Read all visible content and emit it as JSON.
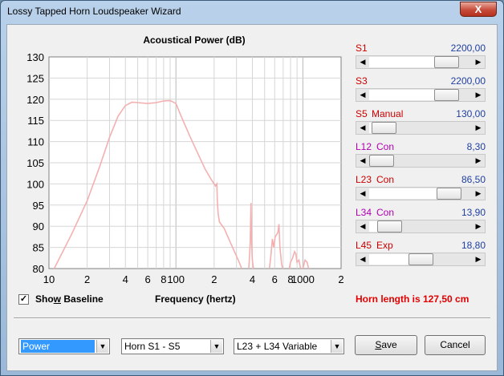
{
  "window": {
    "title": "Lossy Tapped Horn Loudspeaker Wizard",
    "close_label": "X"
  },
  "chart_data": {
    "type": "line",
    "title": "Acoustical Power (dB)",
    "xlabel": "Frequency (hertz)",
    "ylabel": "",
    "xscale": "log",
    "xlim": [
      10,
      2000
    ],
    "ylim": [
      80,
      130
    ],
    "grid": true,
    "y_ticks": [
      "130",
      "125",
      "120",
      "115",
      "110",
      "105",
      "100",
      "95",
      "90",
      "85",
      "80"
    ],
    "x_ticks": [
      "10",
      "2",
      "4",
      "6",
      "8",
      "100",
      "2",
      "4",
      "6",
      "8",
      "1000",
      "2"
    ],
    "line_color": "#f4b0b0",
    "series": [
      {
        "segments": [
          [
            [
              11,
              80
            ],
            [
              15,
              88
            ],
            [
              20,
              96
            ],
            [
              25,
              104
            ],
            [
              30,
              111
            ],
            [
              35,
              116
            ],
            [
              40,
              118.5
            ],
            [
              45,
              119.3
            ],
            [
              50,
              119.2
            ],
            [
              60,
              119
            ],
            [
              70,
              119.2
            ],
            [
              80,
              119.6
            ],
            [
              90,
              119.7
            ],
            [
              100,
              119
            ],
            [
              110,
              116
            ],
            [
              130,
              111
            ],
            [
              150,
              107
            ],
            [
              170,
              103.5
            ],
            [
              190,
              101
            ],
            [
              205,
              99.5
            ],
            [
              210,
              100
            ],
            [
              212,
              96
            ],
            [
              215,
              93
            ],
            [
              220,
              91
            ],
            [
              240,
              89.5
            ],
            [
              270,
              86
            ],
            [
              310,
              82
            ],
            [
              330,
              80
            ]
          ],
          [
            [
              375,
              80
            ],
            [
              385,
              86
            ],
            [
              390,
              95.5
            ],
            [
              395,
              86
            ],
            [
              400,
              82
            ],
            [
              408,
              80
            ]
          ],
          [
            [
              545,
              80
            ],
            [
              560,
              83
            ],
            [
              575,
              87
            ],
            [
              590,
              85
            ],
            [
              605,
              87.5
            ],
            [
              620,
              88
            ],
            [
              635,
              88.5
            ],
            [
              648,
              90.5
            ],
            [
              660,
              85
            ],
            [
              680,
              81
            ],
            [
              695,
              80
            ]
          ],
          [
            [
              780,
              80
            ],
            [
              800,
              81.5
            ],
            [
              830,
              82.5
            ],
            [
              860,
              84
            ],
            [
              880,
              83.5
            ],
            [
              900,
              81.5
            ],
            [
              930,
              82
            ],
            [
              960,
              80
            ]
          ],
          [
            [
              1000,
              80
            ],
            [
              1040,
              82
            ],
            [
              1080,
              81.5
            ],
            [
              1110,
              80
            ]
          ]
        ]
      }
    ]
  },
  "baseline": {
    "label_pre": "Sho",
    "label_u": "w",
    "label_post": " Baseline",
    "checked": "✓"
  },
  "horn_length": "Horn length is 127,50 cm",
  "sliders": [
    {
      "name": "S1",
      "mode": "",
      "value": "2200,00",
      "name_color": "#cc0000",
      "position": 0.84
    },
    {
      "name": "S3",
      "mode": "",
      "value": "2200,00",
      "name_color": "#cc0000",
      "position": 0.84
    },
    {
      "name": "S5",
      "mode": "Manual",
      "value": "130,00",
      "name_color": "#cc0000",
      "position": 0.03
    },
    {
      "name": "L12",
      "mode": "Con",
      "value": "8,30",
      "name_color": "#b000b0",
      "position": 0.0
    },
    {
      "name": "L23",
      "mode": "Con",
      "value": "86,50",
      "name_color": "#cc0000",
      "position": 0.87
    },
    {
      "name": "L34",
      "mode": "Con",
      "value": "13,90",
      "name_color": "#b000b0",
      "position": 0.1
    },
    {
      "name": "L45",
      "mode": "Exp",
      "value": "18,80",
      "name_color": "#cc0000",
      "position": 0.5
    }
  ],
  "combos": {
    "mode": "Power",
    "horn": "Horn S1 - S5",
    "variable": "L23 + L34 Variable"
  },
  "buttons": {
    "save_u": "S",
    "save_rest": "ave",
    "cancel": "Cancel"
  }
}
